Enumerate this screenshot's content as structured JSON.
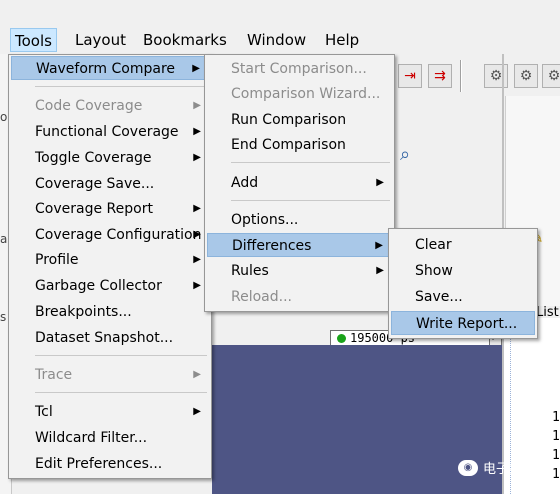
{
  "menubar": {
    "items": [
      {
        "label": "Tools",
        "active": true
      },
      {
        "label": "Layout"
      },
      {
        "label": "Bookmarks"
      },
      {
        "label": "Window"
      },
      {
        "label": "Help"
      }
    ]
  },
  "tools_menu": {
    "items": [
      {
        "label": "Waveform Compare",
        "submenu": true,
        "highlighted": true
      },
      {
        "separator": true
      },
      {
        "label": "Code Coverage",
        "submenu": true,
        "disabled": true
      },
      {
        "label": "Functional Coverage",
        "submenu": true
      },
      {
        "label": "Toggle Coverage",
        "submenu": true
      },
      {
        "label": "Coverage Save..."
      },
      {
        "label": "Coverage Report",
        "submenu": true
      },
      {
        "label": "Coverage Configuration",
        "submenu": true
      },
      {
        "label": "Profile",
        "submenu": true
      },
      {
        "label": "Garbage Collector",
        "submenu": true
      },
      {
        "label": "Breakpoints..."
      },
      {
        "label": "Dataset Snapshot..."
      },
      {
        "separator": true
      },
      {
        "label": "Trace",
        "submenu": true,
        "disabled": true
      },
      {
        "separator": true
      },
      {
        "label": "Tcl",
        "submenu": true
      },
      {
        "label": "Wildcard Filter..."
      },
      {
        "label": "Edit Preferences..."
      }
    ]
  },
  "waveform_compare_menu": {
    "items": [
      {
        "label": "Start Comparison...",
        "disabled": true
      },
      {
        "label": "Comparison Wizard...",
        "disabled": true
      },
      {
        "label": "Run Comparison"
      },
      {
        "label": "End Comparison"
      },
      {
        "separator": true
      },
      {
        "label": "Add",
        "submenu": true
      },
      {
        "separator": true
      },
      {
        "label": "Options..."
      },
      {
        "label": "Differences",
        "submenu": true,
        "highlighted": true
      },
      {
        "label": "Rules",
        "submenu": true
      },
      {
        "label": "Reload...",
        "disabled": true
      }
    ]
  },
  "differences_menu": {
    "items": [
      {
        "label": "Clear"
      },
      {
        "label": "Show"
      },
      {
        "label": "Save..."
      },
      {
        "label": "Write Report...",
        "highlighted": true
      }
    ]
  },
  "wave_window": {
    "time_value": "195000 ps",
    "list_tab": "List",
    "list_values": [
      "1",
      "1",
      "1",
      "1"
    ]
  },
  "left_fragments": [
    "o",
    "ar",
    "s"
  ],
  "watermark": "电子狂人",
  "colors": {
    "menu_highlight": "#a9c8e8",
    "wave_background": "#4e5585",
    "disabled_text": "#8c8c8c"
  }
}
